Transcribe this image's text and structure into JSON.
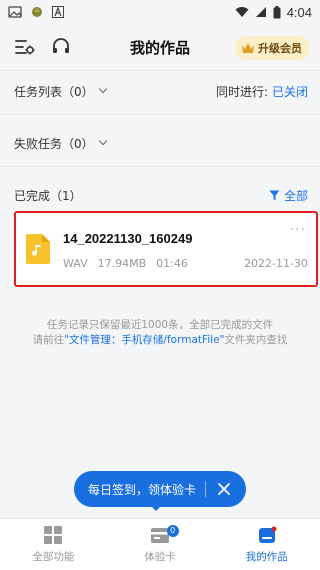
{
  "status_bar": {
    "time": "4:04"
  },
  "header": {
    "title": "我的作品",
    "vip_label": "升级会员"
  },
  "tasks": {
    "task_list_label": "任务列表（0）",
    "concurrent_label": "同时进行:",
    "concurrent_value": "已关闭",
    "failed_label": "失败任务（0）",
    "completed_label": "已完成（1）",
    "filter_label": "全部"
  },
  "file": {
    "name": "14_20221130_160249",
    "format": "WAV",
    "size": "17.94MB",
    "duration": "01:46",
    "date": "2022-11-30",
    "more": "···"
  },
  "notice": {
    "line1": "任务记录只保留最近1000条，全部已完成的文件",
    "line2_prefix": "请前往",
    "line2_link": "\"文件管理：手机存储/formatFile\"",
    "line2_suffix": "文件夹内查找"
  },
  "toast": {
    "text": "每日签到，领体验卡"
  },
  "bottom_nav": {
    "items": [
      {
        "label": "全部功能"
      },
      {
        "label": "体验卡",
        "badge": "0"
      },
      {
        "label": "我的作品"
      }
    ]
  },
  "colors": {
    "accent": "#1a6fe0",
    "highlight": "#e02020",
    "vip_bg": "#fbeec8"
  }
}
